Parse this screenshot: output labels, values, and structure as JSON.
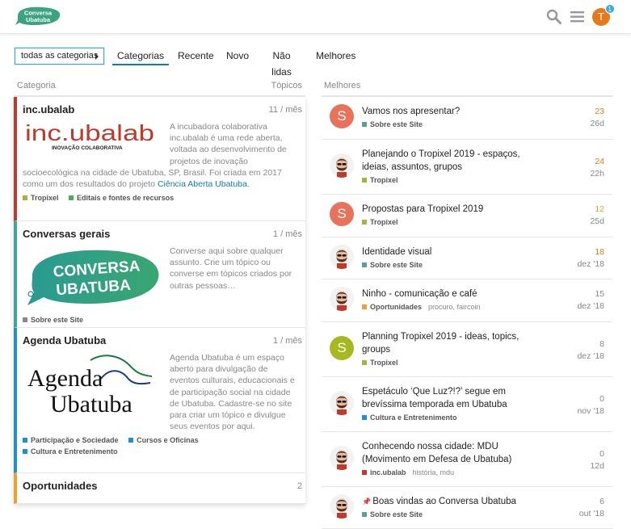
{
  "header": {
    "logo_line1": "Conversa",
    "logo_line2": "Ubatuba",
    "user_initial": "T",
    "notification_count": "1",
    "colors": {
      "logo_green": "#3ba37f",
      "avatar": "#e67a1a",
      "badge": "#38a8e0"
    }
  },
  "nav": {
    "dropdown": "todas as categorias",
    "tabs": [
      "Categorias",
      "Recente",
      "Novo",
      "Não lidas",
      "Melhores"
    ],
    "active_tab": "Categorias"
  },
  "categories": {
    "col_label": "Categoria",
    "topics_label": "Tópicos",
    "items": [
      {
        "name": "inc.ubalab",
        "count": "11 / mês",
        "color": "#c0392b",
        "logo_text": "inc.ubalab",
        "logo_sub": "INOVAÇÃO COLABORATIVA",
        "desc": "A incubadora colaborativa inc.ubalab é uma rede aberta, voltada ao desenvolvimento de projetos de inovação socioecológica na cidade de Ubatuba, SP, Brasil. Foi criada em 2017 como um dos resultados do projeto ",
        "desc_link": "Ciência Aberta Ubatuba",
        "desc_end": ".",
        "subcats": [
          {
            "name": "Tropixel",
            "color": "#a8b33a"
          },
          {
            "name": "Editais e fontes de recursos",
            "color": "#4caf50"
          }
        ]
      },
      {
        "name": "Conversas gerais",
        "count": "1 / mês",
        "color": "#3aa6a0",
        "logo_text1": "CONVERSA",
        "logo_text2": "UBATUBA",
        "desc": "Converse aqui sobre qualquer assunto. Crie um tópico ou converse em tópicos criados por outras pessoas…",
        "subcats": [
          {
            "name": "Sobre este Site",
            "color": "#888888"
          }
        ]
      },
      {
        "name": "Agenda Ubatuba",
        "count": "1 / mês",
        "color": "#1f8fd0",
        "logo_text1": "Agenda",
        "logo_text2": "Ubatuba",
        "desc": "Agenda Ubatuba é um espaço aberto para divulgação de eventos culturais, educacionais e de participação social na cidade de Ubatuba. Cadastre-se no site para criar um tópico e divulgue seus eventos por aqui.",
        "subcats": [
          {
            "name": "Participação e Sociedade",
            "color": "#1f8fd0"
          },
          {
            "name": "Cursos e Oficinas",
            "color": "#1f8fd0"
          },
          {
            "name": "Cultura e Entretenimento",
            "color": "#1f8fd0"
          }
        ]
      },
      {
        "name": "Oportunidades",
        "count": "2",
        "color": "#f0a030"
      }
    ]
  },
  "top": {
    "col_label": "Melhores",
    "topics": [
      {
        "title": "Vamos nos apresentar?",
        "category": "Sobre este Site",
        "cat_color": "#5a9f9a",
        "replies": "23",
        "replies_color": "#e67a1a",
        "date": "26d",
        "avatar": "S",
        "avatar_color": "#e8735a"
      },
      {
        "title": "Planejando o Tropixel 2019 - espaços, ideias, assuntos, grupos",
        "category": "Tropixel",
        "cat_color": "#a8b33a",
        "replies": "24",
        "replies_color": "#e67a1a",
        "date": "22h",
        "avatar": "",
        "avatar_color": "#ffffff"
      },
      {
        "title": "Propostas para Tropixel 2019",
        "category": "Tropixel",
        "cat_color": "#a8b33a",
        "replies": "12",
        "replies_color": "#e69a40",
        "date": "25d",
        "avatar": "S",
        "avatar_color": "#e8735a"
      },
      {
        "title": "Identidade visual",
        "category": "Sobre este Site",
        "cat_color": "#5a9f9a",
        "replies": "18",
        "replies_color": "#e67a1a",
        "date": "dez '18",
        "avatar": "",
        "avatar_color": "#ffffff"
      },
      {
        "title": "Ninho - comunicação e café",
        "category": "Oportunidades",
        "cat_color": "#f0a030",
        "tags": "procuro, faircoin",
        "replies": "15",
        "replies_color": "#888888",
        "date": "dez '18",
        "avatar": "",
        "avatar_color": "#ffffff"
      },
      {
        "title": "Planning Tropixel 2019 - ideas, topics, groups",
        "category": "Tropixel",
        "cat_color": "#a8b33a",
        "replies": "8",
        "replies_color": "#888888",
        "date": "dez '18",
        "avatar": "S",
        "avatar_color": "#a8b820"
      },
      {
        "title": "Espetáculo ‘Que Luz?!?’ segue em brevíssima temporada em Ubatuba",
        "category": "Cultura e Entretenimento",
        "cat_color": "#1f8fd0",
        "replies": "0",
        "replies_color": "#888888",
        "date": "nov '18",
        "avatar": "",
        "avatar_color": "#ffffff"
      },
      {
        "title": "Conhecendo nossa cidade: MDU (Movimento em Defesa de Ubatuba)",
        "category": "inc.ubalab",
        "cat_color": "#c0392b",
        "tags": "história, mdu",
        "replies": "0",
        "replies_color": "#888888",
        "date": "12d",
        "avatar": "",
        "avatar_color": "#ffffff"
      },
      {
        "title": "Boas vindas ao Conversa Ubatuba",
        "category": "Sobre este Site",
        "cat_color": "#5a9f9a",
        "replies": "6",
        "replies_color": "#888888",
        "date": "out '18",
        "avatar": "",
        "avatar_color": "#ffffff",
        "pinned": true
      }
    ]
  }
}
